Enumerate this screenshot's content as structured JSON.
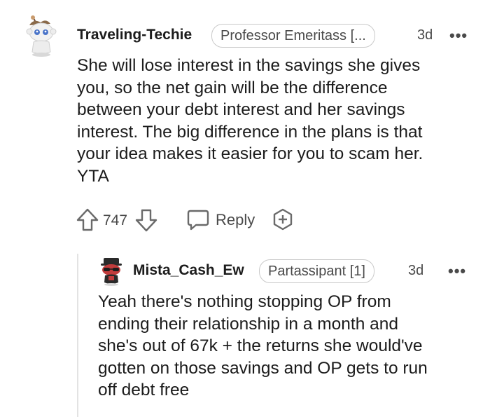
{
  "comment": {
    "username": "Traveling-Techie",
    "flair": "Professor Emeritass [...",
    "time": "3d",
    "more": "•••",
    "lines": [
      "She will lose interest in the savings she gives",
      "you, so the net gain will be the difference",
      "between your debt interest and her savings",
      "interest. The big difference in the plans is that",
      "your idea makes it easier for you to scam her.",
      "YTA"
    ],
    "score": "747",
    "reply_label": "Reply",
    "icons": [
      "snoo-avatar-icon",
      "upvote-icon",
      "downvote-icon",
      "reply-bubble-icon",
      "award-icon",
      "more-icon"
    ]
  },
  "reply": {
    "username": "Mista_Cash_Ew",
    "flair": "Partassipant [1]",
    "time": "3d",
    "more": "•••",
    "lines": [
      "Yeah there's nothing stopping OP from",
      "ending their relationship in a month and",
      "she's out of 67k + the returns she would've",
      "gotten on those savings and OP gets to run",
      "off debt free"
    ]
  },
  "colors": {
    "text": "#1c1c1c",
    "meta": "#4a4a4a",
    "border": "#c9c9c9",
    "thread_line": "#e3e3e3"
  }
}
